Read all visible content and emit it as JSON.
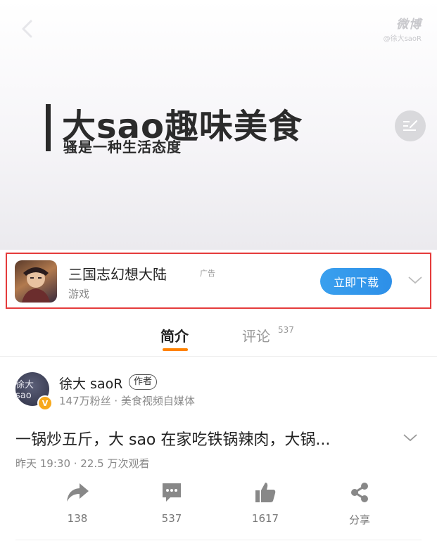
{
  "video": {
    "brand_title": "大sao趣味美食",
    "brand_subtitle": "骚是一种生活态度",
    "watermark_logo": "微博",
    "watermark_user": "@徐大saoR",
    "icons": {
      "back": "back-arrow-icon",
      "danmu": "danmu-toggle-icon"
    }
  },
  "ad": {
    "title": "三国志幻想大陆",
    "tag": "广告",
    "category": "游戏",
    "button_label": "立即下载",
    "accent": "#2d8fe8",
    "highlight_border": "#e53b3b"
  },
  "tabs": [
    {
      "label": "简介",
      "active": true
    },
    {
      "label": "评论",
      "count": "537",
      "active": false
    }
  ],
  "tab_accent": "#ff8200",
  "author": {
    "avatar_text": "徐大sao",
    "name": "徐大 saoR",
    "badge": "作者",
    "meta": "147万粉丝 · 美食视频自媒体",
    "verified_mark": "V"
  },
  "post": {
    "title": "一锅炒五斤，大 sao 在家吃铁锅辣肉，大锅...",
    "meta": "昨天 19:30 · 22.5 万次观看"
  },
  "actions": [
    {
      "icon": "share-arrow-icon",
      "label": "138"
    },
    {
      "icon": "comment-icon",
      "label": "537"
    },
    {
      "icon": "thumbs-up-icon",
      "label": "1617"
    },
    {
      "icon": "share-nodes-icon",
      "label": "分享"
    }
  ]
}
